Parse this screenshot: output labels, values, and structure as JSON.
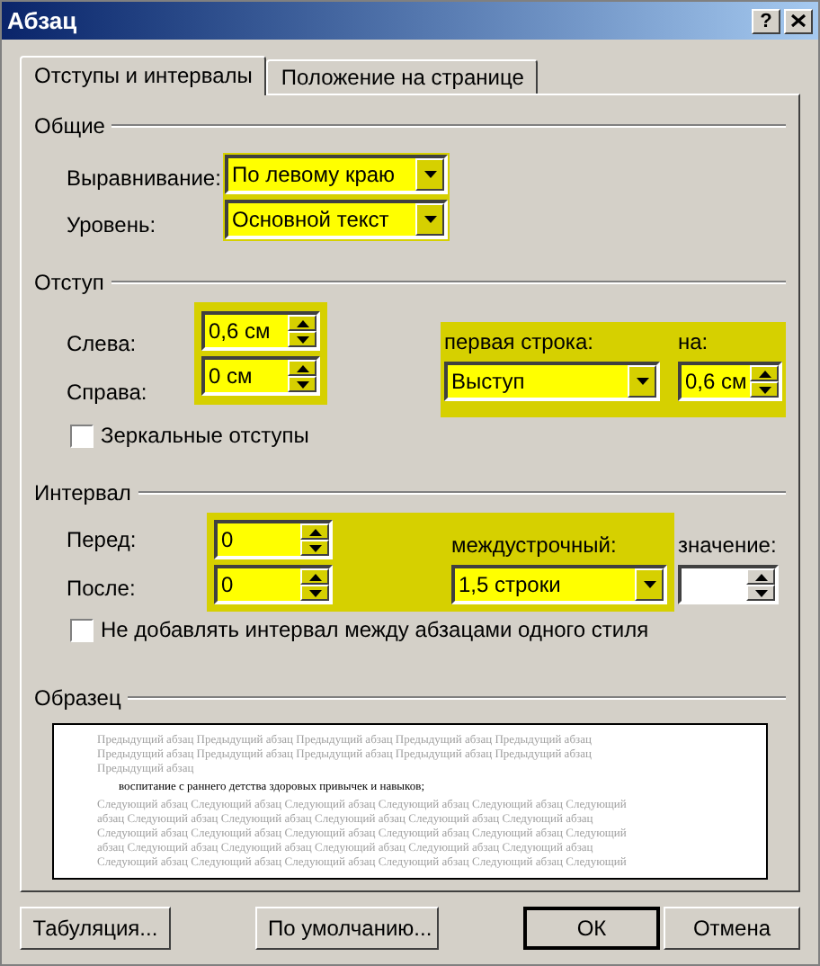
{
  "window": {
    "title": "Абзац",
    "help_button": "?"
  },
  "tabs": [
    {
      "label": "Отступы и интервалы",
      "selected": true
    },
    {
      "label": "Положение на странице",
      "selected": false
    }
  ],
  "general": {
    "title": "Общие",
    "highlighted": true,
    "alignment": {
      "label": "Выравнивание:",
      "value": "По левому краю"
    },
    "level": {
      "label": "Уровень:",
      "value": "Основной текст"
    }
  },
  "indent": {
    "title": "Отступ",
    "sides_highlighted": true,
    "left": {
      "label": "Слева:",
      "value": "0,6 см"
    },
    "right": {
      "label": "Справа:",
      "value": "0 см"
    },
    "first_line_highlighted": true,
    "first_line": {
      "label": "первая строка:",
      "value": "Выступ"
    },
    "by": {
      "label": "на:",
      "value": "0,6 см"
    },
    "mirror": {
      "label": "Зеркальные отступы",
      "checked": false
    }
  },
  "spacing": {
    "title": "Интервал",
    "highlighted": true,
    "before": {
      "label": "Перед:",
      "value": "0"
    },
    "after": {
      "label": "После:",
      "value": "0"
    },
    "line_spacing": {
      "label": "междустрочный:",
      "value": "1,5 строки"
    },
    "at": {
      "label": "значение:"
    },
    "dont_add": {
      "label": "Не добавлять интервал между абзацами одного стиля",
      "checked": false
    }
  },
  "preview": {
    "title": "Образец",
    "previous_lines": [
      "Предыдущий абзац Предыдущий абзац Предыдущий абзац Предыдущий абзац Предыдущий абзац",
      "Предыдущий абзац Предыдущий абзац Предыдущий абзац Предыдущий абзац Предыдущий абзац",
      "Предыдущий абзац"
    ],
    "current_line": "воспитание с раннего детства здоровых привычек и навыков;",
    "next_lines": [
      "Следующий абзац Следующий абзац Следующий абзац Следующий абзац Следующий абзац Следующий",
      "абзац Следующий абзац Следующий абзац Следующий абзац Следующий абзац Следующий абзац",
      "Следующий абзац Следующий абзац Следующий абзац Следующий абзац Следующий абзац Следующий",
      "абзац Следующий абзац Следующий абзац Следующий абзац Следующий абзац Следующий абзац",
      "Следующий абзац Следующий абзац Следующий абзац Следующий абзац Следующий абзац Следующий"
    ]
  },
  "buttons": [
    {
      "label": "Табуляция...",
      "default": false
    },
    {
      "label": "По умолчанию...",
      "default": false
    },
    {
      "label": "ОК",
      "default": true
    },
    {
      "label": "Отмена",
      "default": false
    }
  ]
}
